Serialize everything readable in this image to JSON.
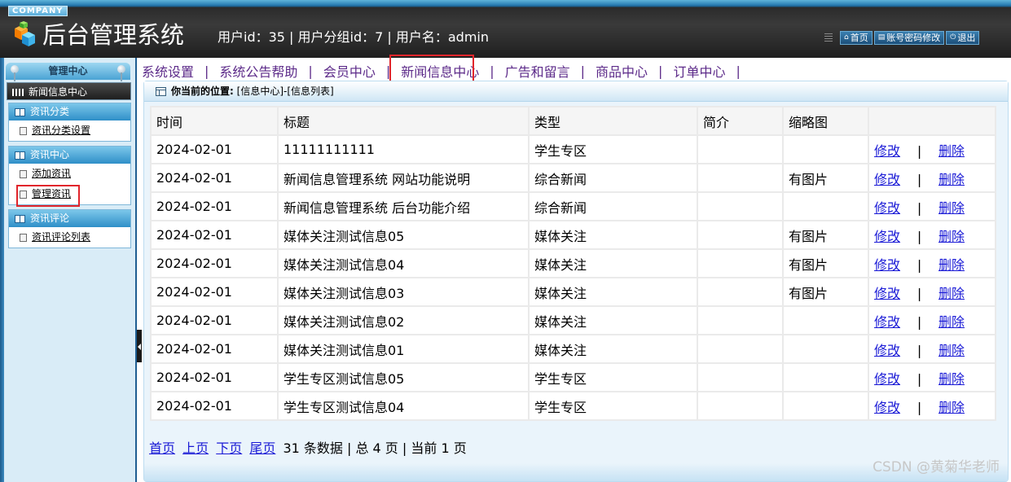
{
  "header": {
    "company": "COMPANY",
    "title": "后台管理系统",
    "user_info": "用户id：35 | 用户分组id：7 | 用户名：admin",
    "links": [
      {
        "icon": "home-icon",
        "label": "首页"
      },
      {
        "icon": "account-icon",
        "label": "账号密码修改"
      },
      {
        "icon": "power-icon",
        "label": "退出"
      }
    ]
  },
  "sidebar": {
    "center_title": "管理中心",
    "section_title": "新闻信息中心",
    "groups": [
      {
        "title": "资讯分类",
        "items": [
          "资讯分类设置"
        ]
      },
      {
        "title": "资讯中心",
        "items": [
          "添加资讯",
          "管理资讯"
        ]
      },
      {
        "title": "资讯评论",
        "items": [
          "资讯评论列表"
        ]
      }
    ]
  },
  "nav": {
    "items": [
      "系统设置",
      "系统公告帮助",
      "会员中心",
      "新闻信息中心",
      "广告和留言",
      "商品中心",
      "订单中心"
    ],
    "separator": "|",
    "active_index": 3
  },
  "breadcrumb": {
    "label": "你当前的位置:",
    "path": "[信息中心]-[信息列表]"
  },
  "table": {
    "headers": [
      "时间",
      "标题",
      "类型",
      "简介",
      "缩略图",
      ""
    ],
    "edit_label": "修改",
    "delete_label": "删除",
    "op_separator": "|",
    "rows": [
      {
        "time": "2024-02-01",
        "title": "11111111111",
        "type": "学生专区",
        "intro": "",
        "thumb": ""
      },
      {
        "time": "2024-02-01",
        "title": "新闻信息管理系统 网站功能说明",
        "type": "综合新闻",
        "intro": "",
        "thumb": "有图片"
      },
      {
        "time": "2024-02-01",
        "title": "新闻信息管理系统 后台功能介绍",
        "type": "综合新闻",
        "intro": "",
        "thumb": ""
      },
      {
        "time": "2024-02-01",
        "title": "媒体关注测试信息05",
        "type": "媒体关注",
        "intro": "",
        "thumb": "有图片"
      },
      {
        "time": "2024-02-01",
        "title": "媒体关注测试信息04",
        "type": "媒体关注",
        "intro": "",
        "thumb": "有图片"
      },
      {
        "time": "2024-02-01",
        "title": "媒体关注测试信息03",
        "type": "媒体关注",
        "intro": "",
        "thumb": "有图片"
      },
      {
        "time": "2024-02-01",
        "title": "媒体关注测试信息02",
        "type": "媒体关注",
        "intro": "",
        "thumb": ""
      },
      {
        "time": "2024-02-01",
        "title": "媒体关注测试信息01",
        "type": "媒体关注",
        "intro": "",
        "thumb": ""
      },
      {
        "time": "2024-02-01",
        "title": "学生专区测试信息05",
        "type": "学生专区",
        "intro": "",
        "thumb": ""
      },
      {
        "time": "2024-02-01",
        "title": "学生专区测试信息04",
        "type": "学生专区",
        "intro": "",
        "thumb": ""
      }
    ]
  },
  "pager": {
    "first": "首页",
    "prev": "上页",
    "next": "下页",
    "last": "尾页",
    "summary": "31 条数据 | 总 4 页 | 当前 1 页"
  },
  "watermark": "CSDN @黄菊华老师",
  "colors": {
    "highlight": "#e1252b",
    "link": "#1a1ad6",
    "nav_text": "#5c2a89"
  }
}
